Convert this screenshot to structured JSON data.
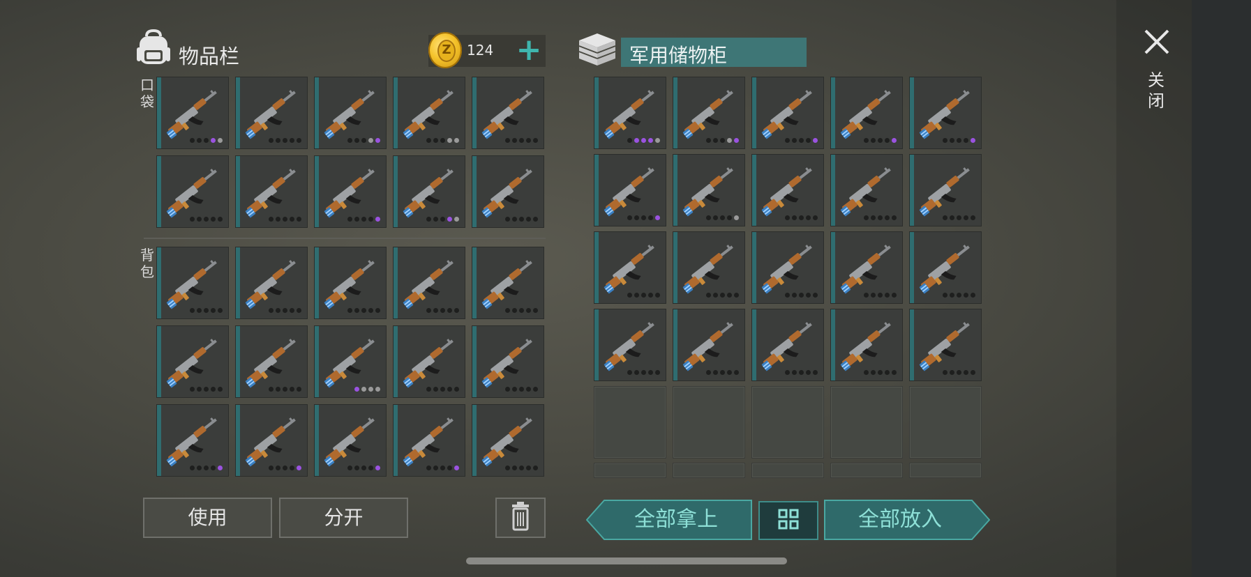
{
  "inventory": {
    "title": "物品栏",
    "icon": "backpack-icon",
    "currency": {
      "icon": "z-coin-icon",
      "letter": "Z",
      "amount": "124",
      "add_icon": "plus-icon"
    },
    "sections": [
      {
        "label": "口袋",
        "rows": 2
      },
      {
        "label": "背包",
        "rows": 3
      }
    ],
    "slots": [
      [
        "d",
        "d",
        "d",
        "p",
        "g"
      ],
      [
        "d",
        "d",
        "d",
        "d",
        "d"
      ],
      [
        "d",
        "d",
        "d",
        "g",
        "p"
      ],
      [
        "d",
        "d",
        "d",
        "g",
        "g"
      ],
      [
        "d",
        "d",
        "d",
        "d",
        "d"
      ],
      [
        "d",
        "d",
        "d",
        "d",
        "d"
      ],
      [
        "d",
        "d",
        "d",
        "d",
        "d"
      ],
      [
        "d",
        "d",
        "d",
        "d",
        "p"
      ],
      [
        "d",
        "d",
        "d",
        "p",
        "g"
      ],
      [
        "d",
        "d",
        "d",
        "d",
        "d"
      ],
      [
        "d",
        "d",
        "d",
        "d",
        "d"
      ],
      [
        "d",
        "d",
        "d",
        "d",
        "d"
      ],
      [
        "d",
        "d",
        "d",
        "d",
        "d"
      ],
      [
        "d",
        "d",
        "d",
        "d",
        "d"
      ],
      [
        "d",
        "d",
        "d",
        "d",
        "d"
      ],
      [
        "d",
        "d",
        "d",
        "d",
        "d"
      ],
      [
        "d",
        "d",
        "d",
        "d",
        "d"
      ],
      [
        "p",
        "g",
        "g",
        "g"
      ],
      [
        "d",
        "d",
        "d",
        "d",
        "d"
      ],
      [
        "d",
        "d",
        "d",
        "d",
        "d"
      ],
      [
        "d",
        "d",
        "d",
        "d",
        "p"
      ],
      [
        "d",
        "d",
        "d",
        "d",
        "p"
      ],
      [
        "d",
        "d",
        "d",
        "d",
        "p"
      ],
      [
        "d",
        "d",
        "d",
        "d",
        "p"
      ],
      [
        "d",
        "d",
        "d",
        "d",
        "d"
      ]
    ],
    "item_icon": "assault-rifle-icon",
    "buttons": {
      "use": "使用",
      "split": "分开",
      "delete_icon": "trash-icon"
    }
  },
  "storage": {
    "title": "军用储物柜",
    "icon": "crate-icon",
    "filled_slots": [
      [
        "d",
        "p",
        "p",
        "p",
        "g"
      ],
      [
        "d",
        "d",
        "d",
        "g",
        "p"
      ],
      [
        "d",
        "d",
        "d",
        "d",
        "p"
      ],
      [
        "d",
        "d",
        "d",
        "d",
        "p"
      ],
      [
        "d",
        "d",
        "d",
        "d",
        "p"
      ],
      [
        "d",
        "d",
        "d",
        "d",
        "p"
      ],
      [
        "d",
        "d",
        "d",
        "d",
        "g"
      ],
      [
        "d",
        "d",
        "d",
        "d",
        "d"
      ],
      [
        "d",
        "d",
        "d",
        "d",
        "d"
      ],
      [
        "d",
        "d",
        "d",
        "d",
        "d"
      ],
      [
        "d",
        "d",
        "d",
        "d",
        "d"
      ],
      [
        "d",
        "d",
        "d",
        "d",
        "d"
      ],
      [
        "d",
        "d",
        "d",
        "d",
        "d"
      ],
      [
        "d",
        "d",
        "d",
        "d",
        "d"
      ],
      [
        "d",
        "d",
        "d",
        "d",
        "d"
      ],
      [
        "d",
        "d",
        "d",
        "d",
        "d"
      ],
      [
        "d",
        "d",
        "d",
        "d",
        "d"
      ],
      [
        "d",
        "d",
        "d",
        "d",
        "d"
      ],
      [
        "d",
        "d",
        "d",
        "d",
        "d"
      ],
      [
        "d",
        "d",
        "d",
        "d",
        "d"
      ]
    ],
    "empty_rows": 2,
    "buttons": {
      "take_all": "全部拿上",
      "toggle_icon": "grid-icon",
      "put_all": "全部放入"
    }
  },
  "close": {
    "icon": "close-icon",
    "label": "关闭"
  },
  "colors": {
    "accent": "#3fb6ae",
    "slot_bar": "#2f6d70",
    "purple_dot": "#9a53e0",
    "grey_dot": "#9a9a9a"
  }
}
